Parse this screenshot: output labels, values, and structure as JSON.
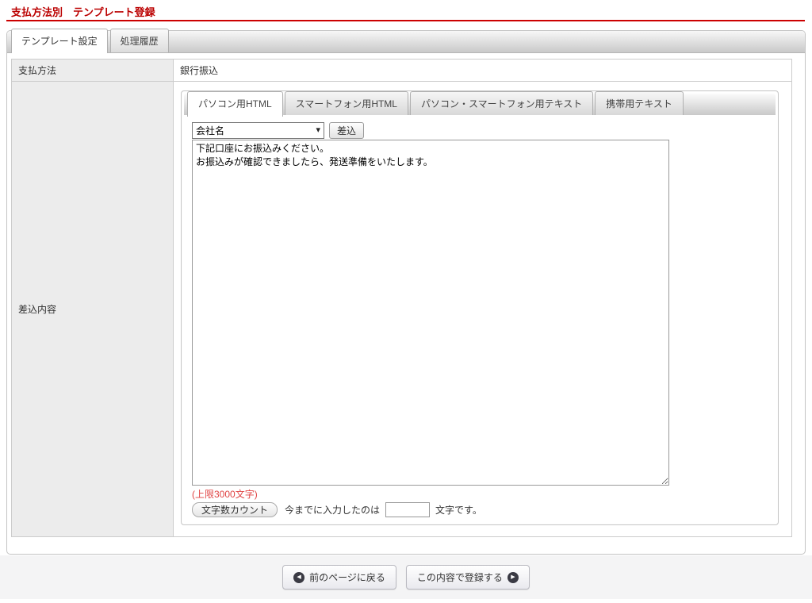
{
  "header": {
    "title": "支払方法別　テンプレート登録"
  },
  "tabs": {
    "items": [
      {
        "label": "テンプレート設定",
        "active": true
      },
      {
        "label": "処理履歴",
        "active": false
      }
    ]
  },
  "form": {
    "payment_method": {
      "label": "支払方法",
      "value": "銀行振込"
    },
    "insert_content": {
      "label": "差込内容",
      "subtabs": [
        "パソコン用HTML",
        "スマートフォン用HTML",
        "パソコン・スマートフォン用テキスト",
        "携帯用テキスト"
      ],
      "merge_field": {
        "selected_option": "会社名",
        "insert_button": "差込",
        "caret_icon": "▾"
      },
      "template_text": "下記口座にお振込みください。\nお振込みが確認できましたら、発送準備をいたします。",
      "limit_note": "(上限3000文字)",
      "char_count": {
        "button": "文字数カウント",
        "text_before": "今までに入力したのは",
        "value": "",
        "text_after": "文字です。"
      }
    }
  },
  "footer": {
    "back_button": "前のページに戻る",
    "back_icon": "◀",
    "submit_button": "この内容で登録する",
    "forward_icon": "▶"
  },
  "colors": {
    "accent_red": "#cc0000",
    "limit_red": "#e04343"
  }
}
